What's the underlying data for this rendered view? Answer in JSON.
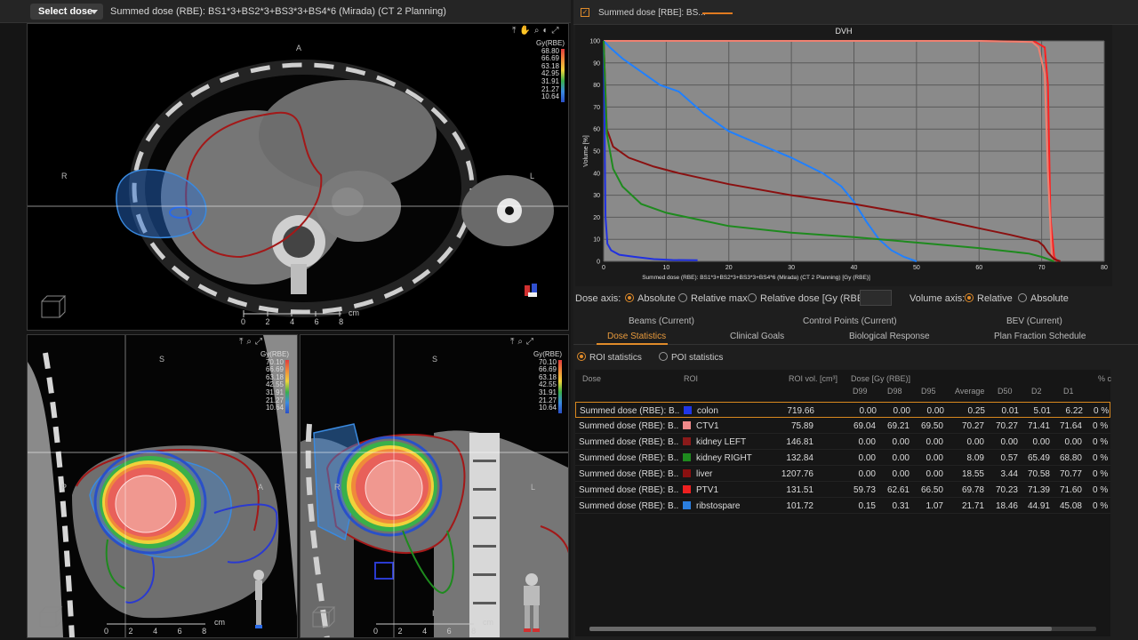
{
  "app": {
    "select_dose_label": "Select dose",
    "dose_title": "Summed dose (RBE): BS1*3+BS2*3+BS3*3+BS4*6 (Mirada) (CT 2 Planning)"
  },
  "views": {
    "axial": {
      "legend_title": "Gy(RBE)",
      "legend_values": [
        "68.80",
        "66.69",
        "63.18",
        "42.95",
        "31.91",
        "21.27",
        "10.64"
      ],
      "orient_top": "A",
      "orient_left": "R",
      "orient_right": "L",
      "scale_label": "cm",
      "scale_ticks": [
        "0",
        "2",
        "4",
        "6",
        "8"
      ]
    },
    "sagittal": {
      "legend_title": "Gy(RBE)",
      "legend_values": [
        "70.10",
        "66.69",
        "63.18",
        "42.55",
        "31.91",
        "21.27",
        "10.64"
      ],
      "orient_top": "S",
      "orient_left": "P",
      "orient_right": "A",
      "scale_label": "cm",
      "scale_ticks": [
        "0",
        "2",
        "4",
        "6",
        "8"
      ]
    },
    "coronal": {
      "legend_title": "Gy(RBE)",
      "legend_values": [
        "70.10",
        "66.69",
        "63.18",
        "42.55",
        "31.91",
        "21.27",
        "10.64"
      ],
      "orient_top": "S",
      "orient_left": "R",
      "orient_right": "L",
      "orient_bottom": "I",
      "scale_label": "cm",
      "scale_ticks": [
        "0",
        "2",
        "4",
        "6",
        "8"
      ]
    }
  },
  "dvh": {
    "tab_label": "Summed dose [RBE]: BS...",
    "chart_title": "DVH",
    "dose_axis_label": "Dose axis:",
    "dose_axis_options": [
      "Absolute",
      "Relative max",
      "Relative dose [Gy (RBE)]:"
    ],
    "dose_axis_selected": "Absolute",
    "volume_axis_label": "Volume axis:",
    "volume_axis_options": [
      "Relative",
      "Absolute"
    ],
    "volume_axis_selected": "Relative"
  },
  "chart_data": {
    "type": "line",
    "title": "DVH",
    "xlabel": "Summed dose (RBE): BS1*3+BS2*3+BS3*3+BS4*6 (Mirada) (CT 2 Planning) [Gy (RBE)]",
    "ylabel": "Volume [%]",
    "xlim": [
      0,
      80
    ],
    "ylim": [
      0,
      100
    ],
    "x_ticks": [
      0,
      10,
      20,
      30,
      40,
      50,
      60,
      70,
      80
    ],
    "y_ticks": [
      0,
      10,
      20,
      30,
      40,
      50,
      60,
      70,
      80,
      90,
      100
    ],
    "grid": true,
    "series": [
      {
        "color": "#ff2020",
        "x": [
          0,
          10,
          20,
          30,
          40,
          50,
          60,
          69,
          70.5,
          71,
          71.4,
          72,
          72.5
        ],
        "y": [
          100,
          100,
          100,
          100,
          100,
          100,
          100,
          99.5,
          97,
          80,
          20,
          2,
          0
        ]
      },
      {
        "color": "#f08070",
        "x": [
          0,
          10,
          20,
          30,
          40,
          50,
          60,
          68.5,
          69.5,
          70.5,
          71,
          71.6,
          72
        ],
        "y": [
          100,
          100,
          100,
          100,
          100,
          100,
          100,
          99.5,
          97,
          85,
          40,
          3,
          0
        ]
      },
      {
        "color": "#2080ff",
        "x": [
          0,
          1,
          3,
          6,
          9,
          12,
          16,
          20,
          25,
          30,
          35,
          38,
          40,
          42,
          44,
          46,
          48,
          50
        ],
        "y": [
          100,
          97,
          92,
          86,
          80,
          77,
          67,
          59,
          53,
          47,
          40,
          34,
          27,
          18,
          10,
          5,
          2,
          0
        ]
      },
      {
        "color": "#2030e0",
        "x": [
          0,
          0.3,
          0.6,
          1.2,
          2.5,
          5,
          8,
          11,
          15
        ],
        "y": [
          100,
          20,
          8,
          5,
          3,
          2,
          1,
          0.6,
          0.5
        ]
      },
      {
        "color": "#8a1010",
        "x": [
          0,
          0.5,
          1.5,
          4,
          8,
          12,
          20,
          30,
          40,
          50,
          60,
          65,
          68,
          69.5,
          70.3,
          71,
          72,
          73
        ],
        "y": [
          100,
          60,
          52,
          47,
          43,
          40,
          35,
          30,
          26,
          21,
          15,
          12,
          10,
          9,
          7,
          4,
          1,
          0
        ]
      },
      {
        "color": "#1e8a1e",
        "x": [
          0,
          0.5,
          1.5,
          3,
          6,
          10,
          15,
          20,
          30,
          40,
          50,
          60,
          68,
          70,
          71,
          72
        ],
        "y": [
          100,
          58,
          42,
          34,
          26,
          22,
          19,
          16,
          13,
          11,
          8.5,
          6,
          3.5,
          2,
          1,
          0
        ]
      }
    ]
  },
  "tabs": {
    "row1": [
      "Beams (Current)",
      "Control Points (Current)",
      "BEV (Current)"
    ],
    "row2": [
      "Dose Statistics",
      "Clinical Goals",
      "Biological Response",
      "Plan Fraction Schedule"
    ],
    "active": "Dose Statistics"
  },
  "roi_options": {
    "roi_label": "ROI statistics",
    "poi_label": "POI statistics",
    "selected": "ROI statistics"
  },
  "table": {
    "headers": {
      "dose": "Dose",
      "roi": "ROI",
      "roi_vol": "ROI vol. [cm³]",
      "dose_group": "Dose [Gy (RBE)]",
      "d99": "D99",
      "d98": "D98",
      "d95": "D95",
      "average": "Average",
      "d50": "D50",
      "d2": "D2",
      "d1": "D1",
      "pct": "% c"
    },
    "rows": [
      {
        "dose": "Summed dose (RBE): B...",
        "roi": "colon",
        "color": "#2036e8",
        "vol": "719.66",
        "d99": "0.00",
        "d98": "0.00",
        "d95": "0.00",
        "avg": "0.25",
        "d50": "0.01",
        "d2": "5.01",
        "d1": "6.22",
        "pct": "0 %"
      },
      {
        "dose": "Summed dose (RBE): B...",
        "roi": "CTV1",
        "color": "#f08a8a",
        "vol": "75.89",
        "d99": "69.04",
        "d98": "69.21",
        "d95": "69.50",
        "avg": "70.27",
        "d50": "70.27",
        "d2": "71.41",
        "d1": "71.64",
        "pct": "0 %"
      },
      {
        "dose": "Summed dose (RBE): B...",
        "roi": "kidney LEFT",
        "color": "#8a1a1a",
        "vol": "146.81",
        "d99": "0.00",
        "d98": "0.00",
        "d95": "0.00",
        "avg": "0.00",
        "d50": "0.00",
        "d2": "0.00",
        "d1": "0.00",
        "pct": "0 %"
      },
      {
        "dose": "Summed dose (RBE): B...",
        "roi": "kidney RIGHT",
        "color": "#1e8a1e",
        "vol": "132.84",
        "d99": "0.00",
        "d98": "0.00",
        "d95": "0.00",
        "avg": "8.09",
        "d50": "0.57",
        "d2": "65.49",
        "d1": "68.80",
        "pct": "0 %"
      },
      {
        "dose": "Summed dose (RBE): B...",
        "roi": "liver",
        "color": "#8a1010",
        "vol": "1207.76",
        "d99": "0.00",
        "d98": "0.00",
        "d95": "0.00",
        "avg": "18.55",
        "d50": "3.44",
        "d2": "70.58",
        "d1": "70.77",
        "pct": "0 %"
      },
      {
        "dose": "Summed dose (RBE): B...",
        "roi": "PTV1",
        "color": "#ee2020",
        "vol": "131.51",
        "d99": "59.73",
        "d98": "62.61",
        "d95": "66.50",
        "avg": "69.78",
        "d50": "70.23",
        "d2": "71.39",
        "d1": "71.60",
        "pct": "0 %"
      },
      {
        "dose": "Summed dose (RBE): B...",
        "roi": "ribstospare",
        "color": "#2b7fe0",
        "vol": "101.72",
        "d99": "0.15",
        "d98": "0.31",
        "d95": "1.07",
        "avg": "21.71",
        "d50": "18.46",
        "d2": "44.91",
        "d1": "45.08",
        "pct": "0 %"
      }
    ]
  },
  "colors": {
    "accent": "#e08b2a",
    "dose_wash": [
      "#e23c3c",
      "#f08a3a",
      "#f0d23a",
      "#3ab04a",
      "#3a8ae0",
      "#2a50c8"
    ]
  },
  "icons": {
    "view_tools": [
      "pan-icon",
      "hand-icon",
      "zoom-icon",
      "window-level-icon",
      "maximize-icon"
    ]
  }
}
